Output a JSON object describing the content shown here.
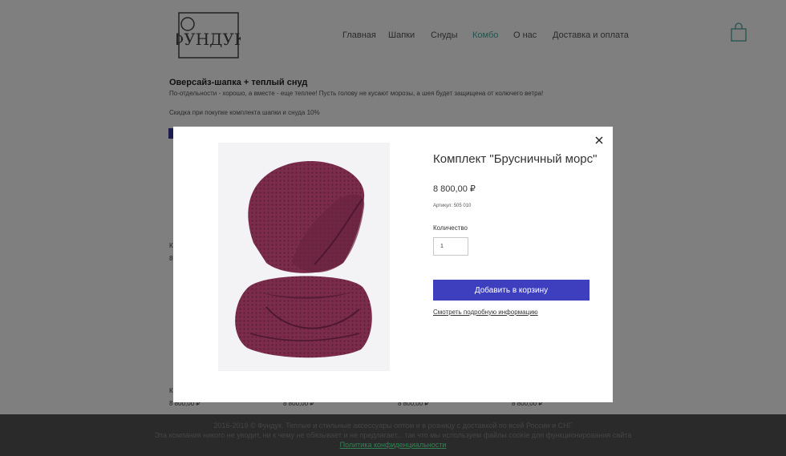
{
  "header": {
    "logo_text": "ФУНДУК",
    "nav": [
      {
        "label": "Главная",
        "active": false
      },
      {
        "label": "Шапки",
        "active": false
      },
      {
        "label": "Снуды",
        "active": false
      },
      {
        "label": "Комбо",
        "active": true
      },
      {
        "label": "О нас",
        "active": false
      },
      {
        "label": "Доставка и оплата",
        "active": false
      }
    ],
    "cart_icon": "shopping-bag-icon",
    "active_color": "#4ba59c"
  },
  "promo": {
    "title": "Оверсайз-шапка + теплый снуд",
    "text": "По-отдельности - хорошо, а вместе - еще теплее! Пусть голову не кусают морозы, а шея будет защищена от колючего ветра!",
    "discount": "Скидка при покупке комплекта шапки и снуда 10%"
  },
  "background_grid": {
    "row1_letters": [
      "К",
      "8"
    ],
    "row2_letter": "К",
    "prices": [
      "8 800,00 ₽",
      "8 800,00 ₽",
      "8 800,00 ₽",
      "8 800,00 ₽"
    ]
  },
  "footer": {
    "line1": "2016-2019 © Фундук. Теплые и стильные аксессуары оптом и в розницу с доставкой по всей России и СНГ",
    "line2": "Эта компания никого не уводит, ни к чему не обязывает и не предлагает... так что мы используем файлы cookie для функционирования сайта",
    "link": "Политика конфиденциальности"
  },
  "modal": {
    "title": "Комплект \"Брусничный морс\"",
    "price": "8 800,00 ₽",
    "sku": "Артикул: 505 010",
    "quantity_label": "Количество",
    "quantity_value": "1",
    "add_to_cart_label": "Добавить в корзину",
    "details_link": "Смотреть подробную информацию",
    "close_icon": "close-icon",
    "button_color": "#3d3fbf",
    "product_color": "#7a2c4a"
  }
}
